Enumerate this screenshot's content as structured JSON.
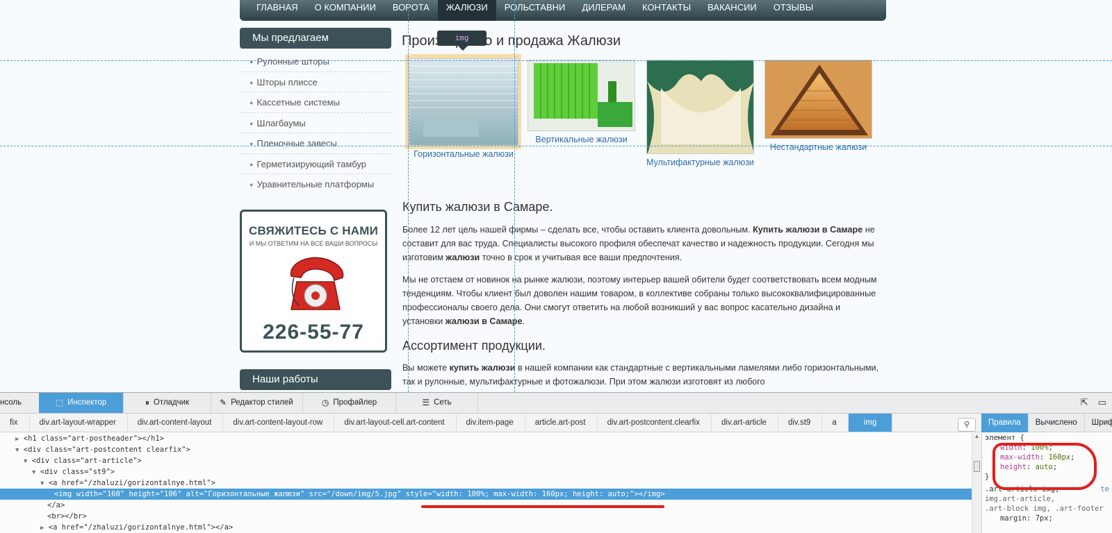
{
  "nav": [
    "ГЛАВНАЯ",
    "О КОМПАНИИ",
    "ВОРОТА",
    "ЖАЛЮЗИ",
    "РОЛЬСТАВНИ",
    "ДИЛЕРАМ",
    "КОНТАКТЫ",
    "ВАКАНСИИ",
    "ОТЗЫВЫ"
  ],
  "sidebar": {
    "offer_title": "Мы предлагаем",
    "items": [
      "Рулонные шторы",
      "Шторы плиссе",
      "Кассетные системы",
      "Шлагбаумы",
      "Пленочные завесы",
      "Герметизирующий тамбур",
      "Уравнительные платформы"
    ],
    "contact": {
      "title": "СВЯЖИТЕСЬ С НАМИ",
      "subtitle": "И МЫ ОТВЕТИМ НА ВСЕ ВАШИ ВОПРОСЫ",
      "phone": "226-55-77"
    },
    "works_title": "Наши работы"
  },
  "main": {
    "title": "Производство и продажа Жалюзи",
    "tooltip": "img",
    "products": [
      {
        "label": "Горизонтальные жалюзи",
        "color1": "#c9dde3",
        "color2": "#8fb0b8"
      },
      {
        "label": "Вертикальные жалюзи",
        "color1": "#5fce3a",
        "color2": "#2f8f22"
      },
      {
        "label": "Мультифактурные жалюзи",
        "color1": "#e8e0b8",
        "color2": "#2c6e4e"
      },
      {
        "label": "Нестандартные жалюзи",
        "color1": "#f0b060",
        "color2": "#6b3a1a"
      }
    ],
    "h_buy": "Купить жалюзи в Самаре.",
    "p1": "Более 12 лет цель нашей фирмы – сделать все, чтобы оставить клиента довольным. Купить жалюзи в Самаре не составит для вас труда. Специалисты высокого профиля обеспечат качество и надежность продукции. Сегодня мы изготовим жалюзи точно в срок и учитывая все ваши предпочтения.",
    "p2": "Мы не отстаем от новинок на рынке жалюзи, поэтому интерьер вашей обители будет соответствовать всем модным тенденциям. Чтобы клиент был доволен нашим товаром, в коллективе собраны только высококвалифицированные профессионалы своего дела. Они смогут ответить на любой возникший у вас вопрос касательно дизайна и установки жалюзи в Самаре.",
    "h_assort": "Ассортимент продукции.",
    "p3": "Вы можете купить жалюзи в нашей компании как стандартные с вертикальными ламелями либо горизонтальными, так и рулонные, мультифактурные и фотожалюзи. При этом жалюзи изготовят из любого"
  },
  "devtools": {
    "tabs": [
      "нсоль",
      "Инспектор",
      "Отладчик",
      "Редактор стилей",
      "Профайлер",
      "Сеть"
    ],
    "breadcrumbs": [
      "fix",
      "div.art-layout-wrapper",
      "div.art-content-layout",
      "div.art-content-layout-row",
      "div.art-layout-cell.art-content",
      "div.item-page",
      "article.art-post",
      "div.art-postcontent.clearfix",
      "div.art-article",
      "div.st9",
      "a",
      "img"
    ],
    "side_tabs": [
      "Правила",
      "Вычислено",
      "Шриф"
    ],
    "markup": [
      "<h1 class=\"art-postheader\"></h1>",
      "<div class=\"art-postcontent clearfix\">",
      "<div class=\"art-article\">",
      "<div class=\"st9\">",
      "<a href=\"/zhaluzi/gorizontalnye.html\">",
      "<img width=\"160\" height=\"106\" alt=\"Горизонтальные жалюзи\" src=\"/down/img/5.jpg\" style=\"width: 100%; max-width: 160px; height: auto;\"></img>",
      "</a>",
      "<br></br>",
      "<a href=\"/zhaluzi/gorizontalnye.html\"></a>"
    ],
    "rules": {
      "element_open": "элемент {",
      "props": [
        {
          "name": "width",
          "value": "100%"
        },
        {
          "name": "max-width",
          "value": "160px"
        },
        {
          "name": "height",
          "value": "auto"
        }
      ],
      "close": "}",
      "rule2_selector": ".art-article img,",
      "rule2_source": "te",
      "rule2_sel2": "img.art-article,",
      "rule2_sel3": ".art-block img, .art-footer",
      "rule2_prop": "margin: 7px;"
    }
  }
}
